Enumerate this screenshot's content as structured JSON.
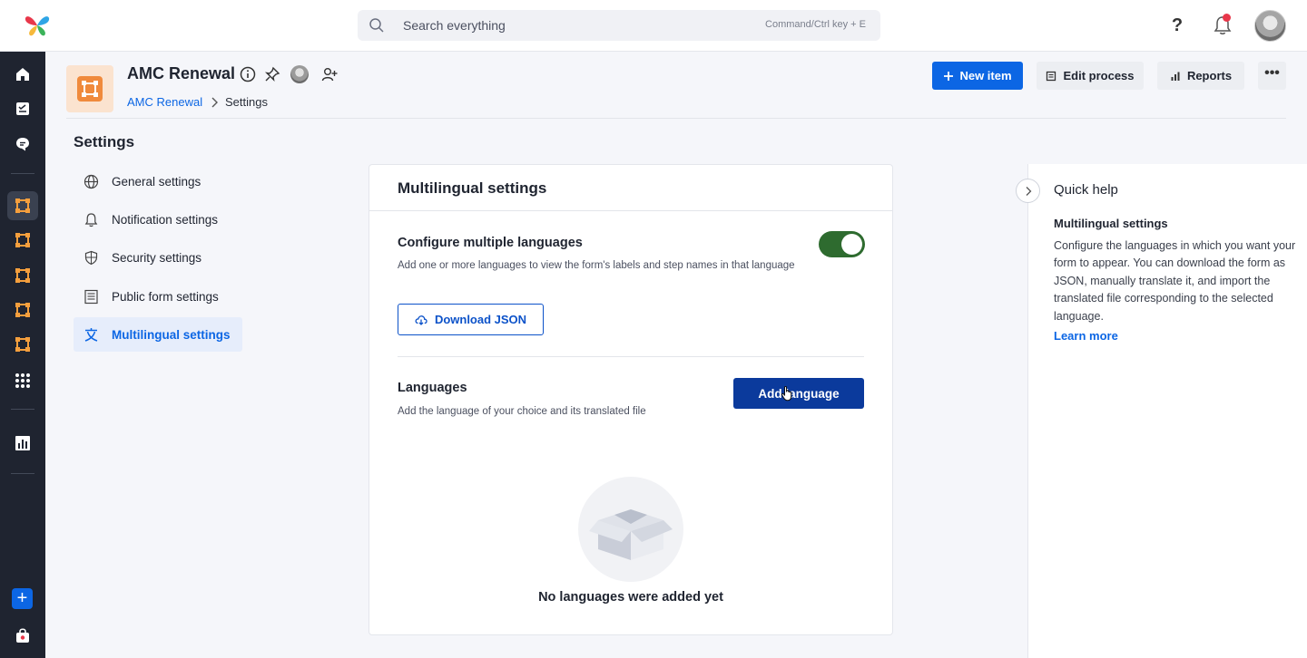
{
  "search": {
    "placeholder": "Search everything",
    "hint": "Command/Ctrl key + E"
  },
  "topbar": {
    "help_label": "?"
  },
  "header": {
    "title": "AMC Renewal",
    "breadcrumb": {
      "link": "AMC Renewal",
      "current": "Settings"
    },
    "new_item_label": "New item",
    "edit_process_label": "Edit process",
    "reports_label": "Reports",
    "more_label": "•••"
  },
  "settings": {
    "title": "Settings",
    "items": [
      {
        "label": "General settings",
        "icon": "globe-icon"
      },
      {
        "label": "Notification settings",
        "icon": "bell-icon"
      },
      {
        "label": "Security settings",
        "icon": "shield-icon"
      },
      {
        "label": "Public form settings",
        "icon": "form-icon"
      },
      {
        "label": "Multilingual settings",
        "icon": "translate-icon",
        "active": true
      }
    ]
  },
  "main": {
    "title": "Multilingual settings",
    "configure": {
      "title": "Configure multiple languages",
      "description": "Add one or more languages to view the form's labels and step names in that language",
      "toggle_on": true,
      "download_label": "Download JSON"
    },
    "languages": {
      "title": "Languages",
      "description": "Add the language of your choice and its translated file",
      "add_label": "Add language",
      "empty_text": "No languages were added yet"
    }
  },
  "quick_help": {
    "title": "Quick help",
    "subtitle": "Multilingual settings",
    "body": "Configure the languages in which you want your form to appear. You can download the form as JSON, manually translate it, and import the translated file corresponding to the selected language.",
    "link": "Learn more"
  },
  "colors": {
    "primary": "#0c66e4",
    "add_button": "#0b3a9c",
    "toggle": "#2e6b2f",
    "rail": "#1f2430",
    "process_accent": "#f08a3c"
  }
}
